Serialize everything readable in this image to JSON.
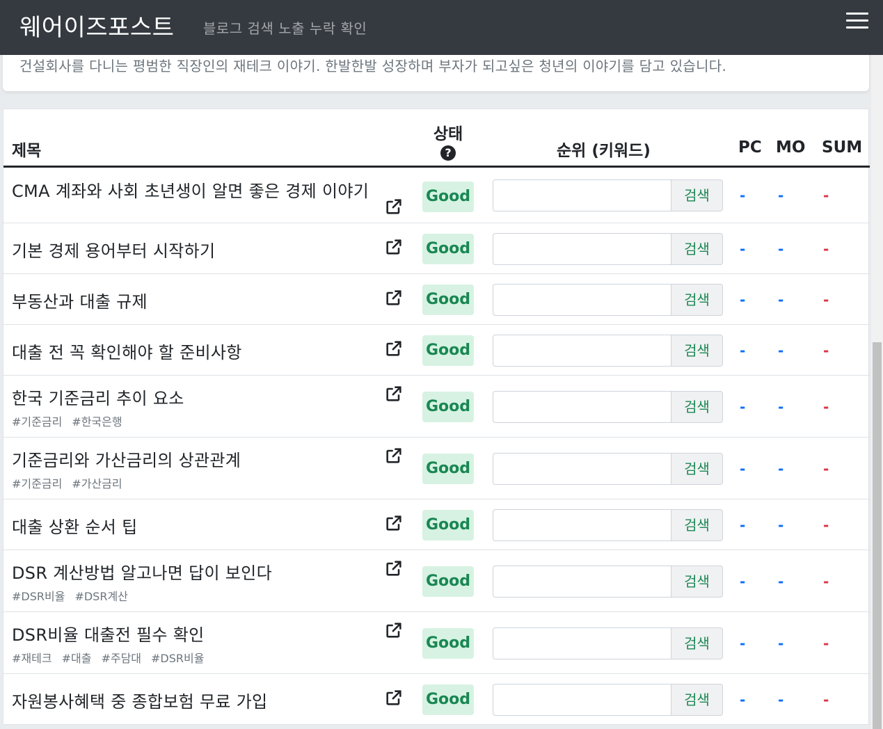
{
  "navbar": {
    "brand": "웨어이즈포스트",
    "subtitle": "블로그 검색 노출 누락 확인"
  },
  "description": "건설회사를 다니는 평범한 직장인의 재테크 이야기. 한발한발 성장하며 부자가 되고싶은 청년의 이야기를 담고 있습니다.",
  "table": {
    "headers": {
      "title": "제목",
      "status": "상태",
      "rank": "순위 (키워드)",
      "pc": "PC",
      "mo": "MO",
      "sum": "SUM"
    },
    "search_label": "검색",
    "rows": [
      {
        "title": "CMA 계좌와 사회 초년생이 알면 좋은 경제 이야기",
        "tags": [],
        "status": "Good",
        "pc": "-",
        "mo": "-",
        "sum": "-"
      },
      {
        "title": "기본 경제 용어부터 시작하기",
        "tags": [],
        "status": "Good",
        "pc": "-",
        "mo": "-",
        "sum": "-"
      },
      {
        "title": "부동산과 대출 규제",
        "tags": [],
        "status": "Good",
        "pc": "-",
        "mo": "-",
        "sum": "-"
      },
      {
        "title": "대출 전 꼭 확인해야 할 준비사항",
        "tags": [],
        "status": "Good",
        "pc": "-",
        "mo": "-",
        "sum": "-"
      },
      {
        "title": "한국 기준금리 추이 요소",
        "tags": [
          "#기준금리",
          "#한국은행"
        ],
        "status": "Good",
        "pc": "-",
        "mo": "-",
        "sum": "-"
      },
      {
        "title": "기준금리와 가산금리의 상관관계",
        "tags": [
          "#기준금리",
          "#가산금리"
        ],
        "status": "Good",
        "pc": "-",
        "mo": "-",
        "sum": "-"
      },
      {
        "title": "대출 상환 순서 팁",
        "tags": [],
        "status": "Good",
        "pc": "-",
        "mo": "-",
        "sum": "-"
      },
      {
        "title": "DSR 계산방법 알고나면 답이 보인다",
        "tags": [
          "#DSR비율",
          "#DSR계산"
        ],
        "status": "Good",
        "pc": "-",
        "mo": "-",
        "sum": "-"
      },
      {
        "title": "DSR비율 대출전 필수 확인",
        "tags": [
          "#재테크",
          "#대출",
          "#주담대",
          "#DSR비율"
        ],
        "status": "Good",
        "pc": "-",
        "mo": "-",
        "sum": "-"
      },
      {
        "title": "자원봉사혜택 중 종합보험 무료 가입",
        "tags": [],
        "status": "Good",
        "pc": "-",
        "mo": "-",
        "sum": "-"
      }
    ]
  },
  "colors": {
    "navbar_bg": "#343a40",
    "good_badge_bg": "#d7f2e2",
    "good_text": "#198754",
    "pc_mo_color": "#0d6efd",
    "sum_color": "#dc3545"
  },
  "icons": {
    "menu": "hamburger-menu-icon",
    "status_help": "question-circle-icon",
    "row_link": "external-link-icon"
  }
}
